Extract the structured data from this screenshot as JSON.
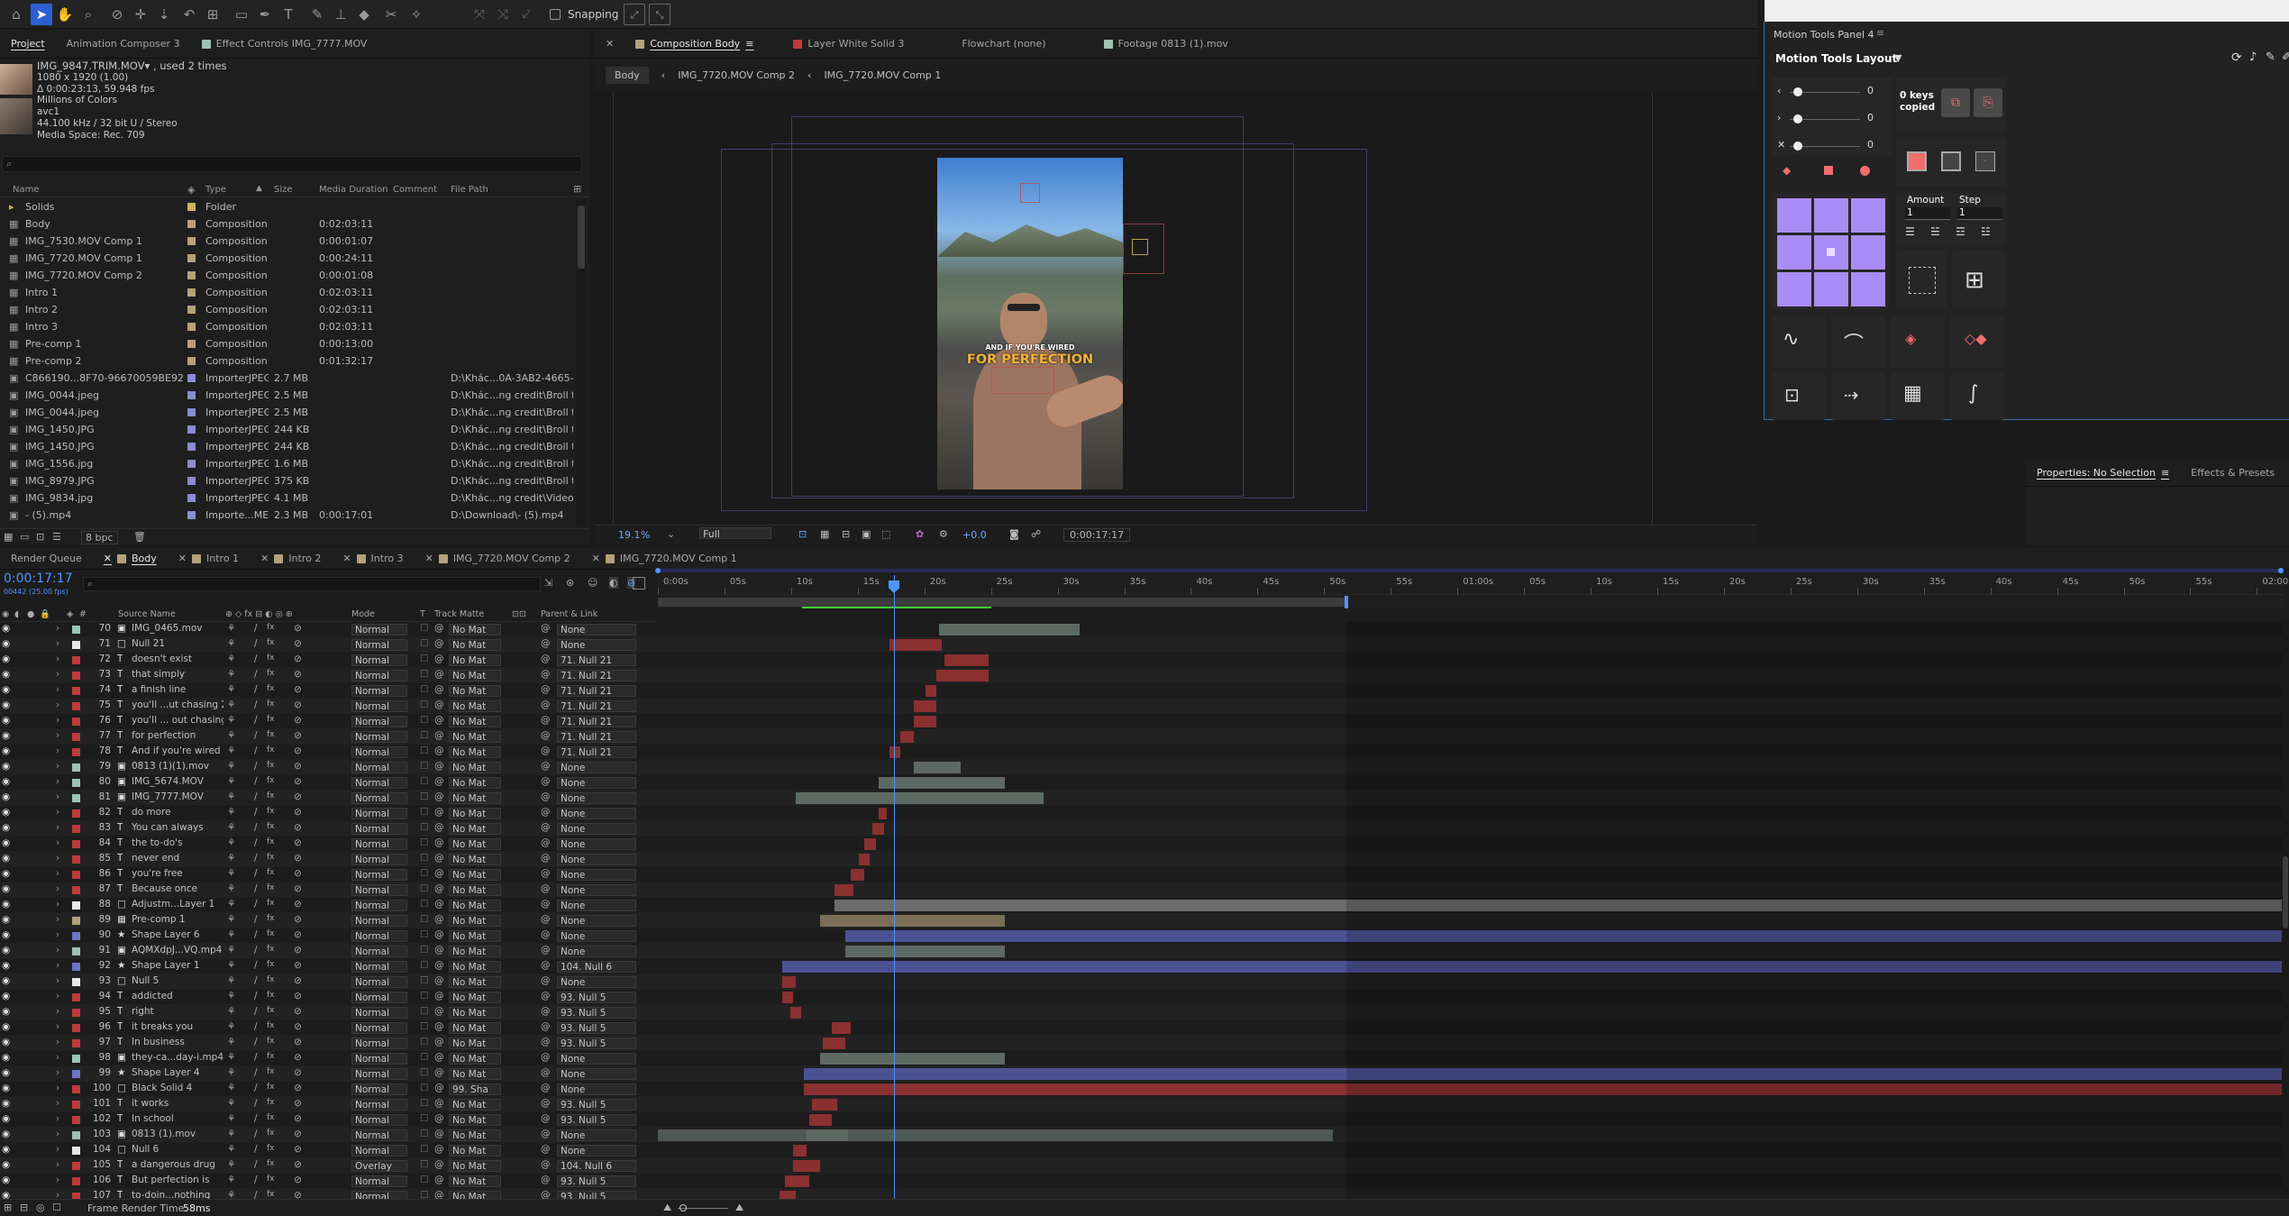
{
  "toolbar": {
    "snapping_label": "Snapping"
  },
  "project_tabs": [
    "Project",
    "Animation Composer 3",
    "Effect Controls IMG_7777.MOV"
  ],
  "project_info": {
    "name": "IMG_9847.TRIM.MOV▾ , used 2 times",
    "size": "1080 x 1920 (1.00)",
    "duration": "Δ 0:00:23:13, 59.948 fps",
    "colors": "Millions of Colors",
    "codec": "avc1",
    "audio": "44.100 kHz / 32 bit U / Stereo",
    "media_space": "Media Space: Rec. 709"
  },
  "project_search_placeholder": "",
  "project_headers": [
    "Name",
    "Type",
    "Size",
    "Media Duration",
    "Comment",
    "File Path"
  ],
  "project_items": [
    {
      "name": "Solids",
      "type": "Folder",
      "size": "",
      "dur": "",
      "path": "",
      "color": "#c8b45a"
    },
    {
      "name": "Body",
      "type": "Composition",
      "size": "",
      "dur": "0:02:03:11",
      "path": "",
      "color": "#b5a17a"
    },
    {
      "name": "IMG_7530.MOV Comp 1",
      "type": "Composition",
      "size": "",
      "dur": "0:00:01:07",
      "path": "",
      "color": "#b5a17a"
    },
    {
      "name": "IMG_7720.MOV Comp 1",
      "type": "Composition",
      "size": "",
      "dur": "0:00:24:11",
      "path": "",
      "color": "#b5a17a"
    },
    {
      "name": "IMG_7720.MOV Comp 2",
      "type": "Composition",
      "size": "",
      "dur": "0:00:01:08",
      "path": "",
      "color": "#b5a17a"
    },
    {
      "name": "Intro 1",
      "type": "Composition",
      "size": "",
      "dur": "0:02:03:11",
      "path": "",
      "color": "#b5a17a"
    },
    {
      "name": "Intro 2",
      "type": "Composition",
      "size": "",
      "dur": "0:02:03:11",
      "path": "",
      "color": "#b5a17a"
    },
    {
      "name": "Intro 3",
      "type": "Composition",
      "size": "",
      "dur": "0:02:03:11",
      "path": "",
      "color": "#b5a17a"
    },
    {
      "name": "Pre-comp 1",
      "type": "Composition",
      "size": "",
      "dur": "0:00:13:00",
      "path": "",
      "color": "#b5a17a"
    },
    {
      "name": "Pre-comp 2",
      "type": "Composition",
      "size": "",
      "dur": "0:01:32:17",
      "path": "",
      "color": "#b5a17a"
    },
    {
      "name": "C866190...8F70-96670059BE92.jpg",
      "type": "ImporterJPEG",
      "size": "2.7 MB",
      "dur": "",
      "path": "D:\\Khác...0A-3AB2-4665-BF",
      "color": "#8b8bd1"
    },
    {
      "name": "IMG_0044.jpeg",
      "type": "ImporterJPEG",
      "size": "2.5 MB",
      "dur": "",
      "path": "D:\\Khác...ng credit\\Broll tồn",
      "color": "#8b8bd1"
    },
    {
      "name": "IMG_0044.jpeg",
      "type": "ImporterJPEG",
      "size": "2.5 MB",
      "dur": "",
      "path": "D:\\Khác...ng credit\\Broll tồn",
      "color": "#8b8bd1"
    },
    {
      "name": "IMG_1450.JPG",
      "type": "ImporterJPEG",
      "size": "244 KB",
      "dur": "",
      "path": "D:\\Khác...ng credit\\Broll tồn",
      "color": "#8b8bd1"
    },
    {
      "name": "IMG_1450.JPG",
      "type": "ImporterJPEG",
      "size": "244 KB",
      "dur": "",
      "path": "D:\\Khác...ng credit\\Broll tồn",
      "color": "#8b8bd1"
    },
    {
      "name": "IMG_1556.jpg",
      "type": "ImporterJPEG",
      "size": "1.6 MB",
      "dur": "",
      "path": "D:\\Khác...ng credit\\Broll tồn",
      "color": "#8b8bd1"
    },
    {
      "name": "IMG_8979.JPG",
      "type": "ImporterJPEG",
      "size": "375 KB",
      "dur": "",
      "path": "D:\\Khác...ng credit\\Broll tồn",
      "color": "#8b8bd1"
    },
    {
      "name": "IMG_9834.jpg",
      "type": "ImporterJPEG",
      "size": "4.1 MB",
      "dur": "",
      "path": "D:\\Khác...ng credit\\Video 5\\",
      "color": "#8b8bd1"
    },
    {
      "name": "- (5).mp4",
      "type": "Importe...MEX",
      "size": "2.3 MB",
      "dur": "0:00:17:01",
      "path": "D:\\Download\\- (5).mp4",
      "color": "#8b8bd1"
    }
  ],
  "project_footer": {
    "bpc": "8 bpc"
  },
  "comp_tabs": {
    "comp_tab": "Composition Body",
    "layer_tab": "Layer White Solid 3",
    "flowchart_tab": "Flowchart (none)",
    "footage_tab": "Footage 0813 (1).mov"
  },
  "breadcrumbs": [
    "Body",
    "IMG_7720.MOV Comp 2",
    "IMG_7720.MOV Comp 1"
  ],
  "viewer_text": {
    "line1": "AND IF YOU'RE WIRED",
    "line2": "FOR PERFECTION"
  },
  "viewer_footer": {
    "zoom": "19.1",
    "zoom_unit": "%",
    "resolution": "Full",
    "exposure": "+0.0",
    "timecode": "0:00:17:17"
  },
  "motion_tools": {
    "panel_title": "Motion Tools Panel 4",
    "layout_label": "Motion Tools Layout",
    "sliders": [
      "0",
      "0",
      "0"
    ],
    "keys_copied_line1": "0 keys",
    "keys_copied_line2": "copied",
    "amount_label": "Amount",
    "step_label": "Step",
    "amount_value": "1",
    "step_value": "1",
    "accent": "#a98cf5"
  },
  "properties": {
    "title": "Properties: No Selection",
    "effects_tab": "Effects & Presets"
  },
  "timeline_tabs": [
    "Render Queue",
    "Body",
    "Intro 1",
    "Intro 2",
    "Intro 3",
    "IMG_7720.MOV Comp 2",
    "IMG_7720.MOV Comp 1"
  ],
  "timeline": {
    "timecode": "0:00:17:17",
    "frames": "00442 (25.00 fps)",
    "col_source": "Source Name",
    "col_mode": "Mode",
    "col_t": "T",
    "col_matte": "Track Matte",
    "col_parent": "Parent & Link",
    "render_time_label": "Frame Render Time:",
    "render_time_value": "58ms"
  },
  "ruler": [
    "0:00s",
    "05s",
    "10s",
    "15s",
    "20s",
    "25s",
    "30s",
    "35s",
    "40s",
    "45s",
    "50s",
    "55s",
    "01:00s",
    "05s",
    "10s",
    "15s",
    "20s",
    "25s",
    "30s",
    "35s",
    "40s",
    "45s",
    "50s",
    "55s",
    "02:00s"
  ],
  "layers": [
    {
      "num": "70",
      "icon": "▣",
      "name": "IMG_0465.mov",
      "mode": "Normal",
      "matte": "No Mat",
      "parent": "None",
      "color": "#9bc4b3",
      "bars": [
        [
          204,
          306,
          "#5d6a63"
        ]
      ]
    },
    {
      "num": "71",
      "icon": "□",
      "name": "Null 21",
      "mode": "Normal",
      "matte": "No Mat",
      "parent": "None",
      "color": "#e8e8e8",
      "bars": [
        [
          168,
          206,
          "#8a3030"
        ]
      ]
    },
    {
      "num": "72",
      "icon": "T",
      "name": "doesn't exist",
      "mode": "Normal",
      "matte": "No Mat",
      "parent": "71. Null 21",
      "color": "#c03a3a",
      "bars": [
        [
          208,
          240,
          "#8a3030"
        ]
      ]
    },
    {
      "num": "73",
      "icon": "T",
      "name": "that simply",
      "mode": "Normal",
      "matte": "No Mat",
      "parent": "71. Null 21",
      "color": "#c03a3a",
      "bars": [
        [
          202,
          240,
          "#8a3030"
        ]
      ]
    },
    {
      "num": "74",
      "icon": "T",
      "name": "a finish line",
      "mode": "Normal",
      "matte": "No Mat",
      "parent": "71. Null 21",
      "color": "#c03a3a",
      "bars": [
        [
          194,
          202,
          "#8a3030"
        ]
      ]
    },
    {
      "num": "75",
      "icon": "T",
      "name": "you'll ...ut chasing 2",
      "mode": "Normal",
      "matte": "No Mat",
      "parent": "71. Null 21",
      "color": "#c03a3a",
      "bars": [
        [
          186,
          202,
          "#8a3030"
        ]
      ]
    },
    {
      "num": "76",
      "icon": "T",
      "name": "you'll ... out chasing",
      "mode": "Normal",
      "matte": "No Mat",
      "parent": "71. Null 21",
      "color": "#c03a3a",
      "bars": [
        [
          186,
          202,
          "#8a3030"
        ]
      ]
    },
    {
      "num": "77",
      "icon": "T",
      "name": "for perfection",
      "mode": "Normal",
      "matte": "No Mat",
      "parent": "71. Null 21",
      "color": "#c03a3a",
      "bars": [
        [
          176,
          186,
          "#8a3030"
        ]
      ]
    },
    {
      "num": "78",
      "icon": "T",
      "name": "And if you're wired",
      "mode": "Normal",
      "matte": "No Mat",
      "parent": "71. Null 21",
      "color": "#c03a3a",
      "bars": [
        [
          168,
          176,
          "#8a3030"
        ]
      ]
    },
    {
      "num": "79",
      "icon": "▣",
      "name": "0813 (1)(1).mov",
      "mode": "Normal",
      "matte": "No Mat",
      "parent": "None",
      "color": "#9bc4b3",
      "bars": [
        [
          186,
          220,
          "#5d6a63"
        ]
      ]
    },
    {
      "num": "80",
      "icon": "▣",
      "name": "IMG_5674.MOV",
      "mode": "Normal",
      "matte": "No Mat",
      "parent": "None",
      "color": "#9bc4b3",
      "bars": [
        [
          160,
          252,
          "#5d6a63"
        ]
      ]
    },
    {
      "num": "81",
      "icon": "▣",
      "name": "IMG_7777.MOV",
      "mode": "Normal",
      "matte": "No Mat",
      "parent": "None",
      "color": "#9bc4b3",
      "bars": [
        [
          100,
          280,
          "#5d6a63"
        ]
      ]
    },
    {
      "num": "82",
      "icon": "T",
      "name": "do more",
      "mode": "Normal",
      "matte": "No Mat",
      "parent": "None",
      "color": "#c03a3a",
      "bars": [
        [
          160,
          166,
          "#8a3030"
        ]
      ]
    },
    {
      "num": "83",
      "icon": "T",
      "name": "You can always",
      "mode": "Normal",
      "matte": "No Mat",
      "parent": "None",
      "color": "#c03a3a",
      "bars": [
        [
          156,
          164,
          "#8a3030"
        ]
      ]
    },
    {
      "num": "84",
      "icon": "T",
      "name": "the to-do's",
      "mode": "Normal",
      "matte": "No Mat",
      "parent": "None",
      "color": "#c03a3a",
      "bars": [
        [
          150,
          158,
          "#8a3030"
        ]
      ]
    },
    {
      "num": "85",
      "icon": "T",
      "name": "never end",
      "mode": "Normal",
      "matte": "No Mat",
      "parent": "None",
      "color": "#c03a3a",
      "bars": [
        [
          146,
          154,
          "#8a3030"
        ]
      ]
    },
    {
      "num": "86",
      "icon": "T",
      "name": "you're free",
      "mode": "Normal",
      "matte": "No Mat",
      "parent": "None",
      "color": "#c03a3a",
      "bars": [
        [
          140,
          150,
          "#8a3030"
        ]
      ]
    },
    {
      "num": "87",
      "icon": "T",
      "name": "Because once",
      "mode": "Normal",
      "matte": "No Mat",
      "parent": "None",
      "color": "#c03a3a",
      "bars": [
        [
          128,
          142,
          "#8a3030"
        ]
      ]
    },
    {
      "num": "88",
      "icon": "□",
      "name": "Adjustm...Layer 1",
      "mode": "Normal",
      "matte": "No Mat",
      "parent": "None",
      "color": "#e8e8e8",
      "bars": [
        [
          128,
          1190,
          "#6c6c6c"
        ]
      ]
    },
    {
      "num": "89",
      "icon": "▦",
      "name": "Pre-comp 1",
      "mode": "Normal",
      "matte": "No Mat",
      "parent": "None",
      "color": "#b5a17a",
      "bars": [
        [
          118,
          252,
          "#7a6e57"
        ]
      ]
    },
    {
      "num": "90",
      "icon": "★",
      "name": "Shape Layer 6",
      "mode": "Normal",
      "matte": "No Mat",
      "parent": "None",
      "color": "#6c74c8",
      "bars": [
        [
          136,
          1180,
          "#4b5294"
        ]
      ]
    },
    {
      "num": "91",
      "icon": "▣",
      "name": "AQMXdpJ...VQ.mp4",
      "mode": "Normal",
      "matte": "No Mat",
      "parent": "None",
      "color": "#9bc4b3",
      "bars": [
        [
          136,
          252,
          "#5d6a63"
        ]
      ]
    },
    {
      "num": "92",
      "icon": "★",
      "name": "Shape Layer 1",
      "mode": "Normal",
      "matte": "No Mat",
      "parent": "104. Null 6",
      "color": "#6c74c8",
      "bars": [
        [
          90,
          1190,
          "#4b5294"
        ]
      ]
    },
    {
      "num": "93",
      "icon": "□",
      "name": "Null 5",
      "mode": "Normal",
      "matte": "No Mat",
      "parent": "None",
      "color": "#e8e8e8",
      "bars": [
        [
          90,
          100,
          "#8a3030"
        ]
      ]
    },
    {
      "num": "94",
      "icon": "T",
      "name": "addicted",
      "mode": "Normal",
      "matte": "No Mat",
      "parent": "93. Null 5",
      "color": "#c03a3a",
      "bars": [
        [
          90,
          98,
          "#8a3030"
        ]
      ]
    },
    {
      "num": "95",
      "icon": "T",
      "name": "right",
      "mode": "Normal",
      "matte": "No Mat",
      "parent": "93. Null 5",
      "color": "#c03a3a",
      "bars": [
        [
          96,
          104,
          "#8a3030"
        ]
      ]
    },
    {
      "num": "96",
      "icon": "T",
      "name": "it breaks you",
      "mode": "Normal",
      "matte": "No Mat",
      "parent": "93. Null 5",
      "color": "#c03a3a",
      "bars": [
        [
          126,
          140,
          "#8a3030"
        ]
      ]
    },
    {
      "num": "97",
      "icon": "T",
      "name": "In business",
      "mode": "Normal",
      "matte": "No Mat",
      "parent": "93. Null 5",
      "color": "#c03a3a",
      "bars": [
        [
          120,
          136,
          "#8a3030"
        ]
      ]
    },
    {
      "num": "98",
      "icon": "▣",
      "name": "they-ca...day-i.mp4",
      "mode": "Normal",
      "matte": "No Mat",
      "parent": "None",
      "color": "#9bc4b3",
      "bars": [
        [
          118,
          252,
          "#5d6a63"
        ]
      ]
    },
    {
      "num": "99",
      "icon": "★",
      "name": "Shape Layer 4",
      "mode": "Normal",
      "matte": "No Mat",
      "parent": "None",
      "color": "#6c74c8",
      "bars": [
        [
          106,
          1180,
          "#4b5294"
        ]
      ]
    },
    {
      "num": "100",
      "icon": "□",
      "name": "Black Solid 4",
      "mode": "Normal",
      "matte": "99. Sha",
      "parent": "None",
      "color": "#c03a3a",
      "bars": [
        [
          106,
          1190,
          "#8a3030"
        ]
      ]
    },
    {
      "num": "101",
      "icon": "T",
      "name": "it works",
      "mode": "Normal",
      "matte": "No Mat",
      "parent": "93. Null 5",
      "color": "#c03a3a",
      "bars": [
        [
          112,
          130,
          "#8a3030"
        ]
      ]
    },
    {
      "num": "102",
      "icon": "T",
      "name": "In school",
      "mode": "Normal",
      "matte": "No Mat",
      "parent": "93. Null 5",
      "color": "#c03a3a",
      "bars": [
        [
          110,
          126,
          "#8a3030"
        ]
      ]
    },
    {
      "num": "103",
      "icon": "▣",
      "name": "0813 (1).mov",
      "mode": "Normal",
      "matte": "No Mat",
      "parent": "None",
      "color": "#9bc4b3",
      "bars": [
        [
          0,
          490,
          "#4f5a55"
        ],
        [
          108,
          138,
          "#5d6a63"
        ]
      ]
    },
    {
      "num": "104",
      "icon": "□",
      "name": "Null 6",
      "mode": "Normal",
      "matte": "No Mat",
      "parent": "None",
      "color": "#e8e8e8",
      "bars": [
        [
          98,
          108,
          "#8a3030"
        ]
      ]
    },
    {
      "num": "105",
      "icon": "T",
      "name": "a dangerous drug",
      "mode": "Overlay",
      "matte": "No Mat",
      "parent": "104. Null 6",
      "color": "#c03a3a",
      "bars": [
        [
          98,
          118,
          "#8a3030"
        ]
      ]
    },
    {
      "num": "106",
      "icon": "T",
      "name": "But perfection is",
      "mode": "Normal",
      "matte": "No Mat",
      "parent": "93. Null 5",
      "color": "#c03a3a",
      "bars": [
        [
          92,
          110,
          "#8a3030"
        ]
      ]
    },
    {
      "num": "107",
      "icon": "T",
      "name": "to-doin...nothing",
      "mode": "Normal",
      "matte": "No Mat",
      "parent": "93. Null 5",
      "color": "#c03a3a",
      "bars": [
        [
          88,
          100,
          "#8a3030"
        ]
      ]
    }
  ]
}
